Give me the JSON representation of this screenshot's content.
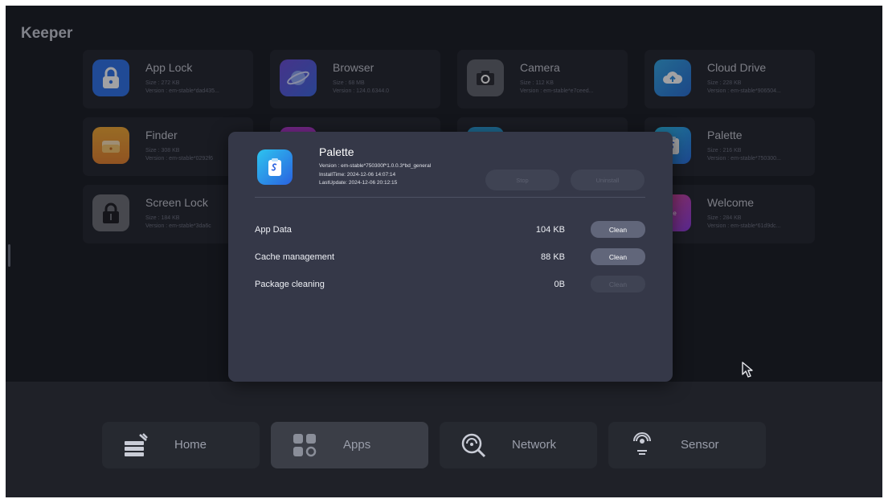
{
  "app": {
    "title": "Keeper"
  },
  "apps": [
    {
      "name": "App Lock",
      "size": "Size : 272 KB",
      "version": "Version : em-stable*dad435...",
      "icon": "padlock-icon",
      "color": "#2f73e8"
    },
    {
      "name": "Browser",
      "size": "Size : 68 MB",
      "version": "Version : 124.0.6344.0",
      "icon": "planet-icon",
      "color": "#5a58de"
    },
    {
      "name": "Camera",
      "size": "Size : 112 KB",
      "version": "Version : em-stable*e7ceed...",
      "icon": "camera-icon",
      "color": "#61646c"
    },
    {
      "name": "Cloud Drive",
      "size": "Size : 228 KB",
      "version": "Version : em-stable*906504...",
      "icon": "cloud-icon",
      "color": "#2f8fe0"
    },
    {
      "name": "Finder",
      "size": "Size : 308 KB",
      "version": "Version : em-stable*0292f6",
      "icon": "folder-icon",
      "color": "#eb9630"
    },
    {
      "name": "",
      "size": "",
      "version": "",
      "icon": "app-icon",
      "color": "#b53ad0"
    },
    {
      "name": "",
      "size": "",
      "version": "",
      "icon": "app-icon",
      "color": "#2a9fd8"
    },
    {
      "name": "Palette",
      "size": "Size : 216 KB",
      "version": "Version : em-stable*750300...",
      "icon": "clipboard-icon",
      "color": "#2a8fe8"
    },
    {
      "name": "Screen Lock",
      "size": "Size : 184 KB",
      "version": "Version : em-stable*3da6c",
      "icon": "screen-lock-icon",
      "color": "#6e7077"
    },
    {
      "name": "",
      "size": "",
      "version": "",
      "icon": "",
      "color": ""
    },
    {
      "name": "",
      "size": "",
      "version": "",
      "icon": "",
      "color": ""
    },
    {
      "name": "Welcome",
      "size": "Size : 284 KB",
      "version": "Version : em-stable*61d9dc...",
      "icon": "welcome-icon",
      "color": "#c144b8",
      "icon_text": "come"
    }
  ],
  "dialog": {
    "app_name": "Palette",
    "version": "Version : em-stable*750300f*1.0.0.3*bd_general",
    "install_time": "InstallTime: 2024-12-06 14:07:14",
    "last_update": "LastUpdate: 2024-12-06 20:12:15",
    "stop_label": "Stop",
    "uninstall_label": "Uninstall",
    "rows": [
      {
        "label": "App Data",
        "value": "104 KB",
        "action": "Clean",
        "enabled": true
      },
      {
        "label": "Cache management",
        "value": "88 KB",
        "action": "Clean",
        "enabled": true
      },
      {
        "label": "Package cleaning",
        "value": "0B",
        "action": "Clean",
        "enabled": false
      }
    ]
  },
  "nav": [
    {
      "label": "Home",
      "icon": "home-icon",
      "active": false
    },
    {
      "label": "Apps",
      "icon": "apps-icon",
      "active": true
    },
    {
      "label": "Network",
      "icon": "network-icon",
      "active": false
    },
    {
      "label": "Sensor",
      "icon": "sensor-icon",
      "active": false
    }
  ],
  "colors": {
    "background": "#1b1d24",
    "card": "#24272f",
    "dialog": "#353848",
    "clean_button": "#61667a",
    "accent_blue": "#2f73e8"
  }
}
